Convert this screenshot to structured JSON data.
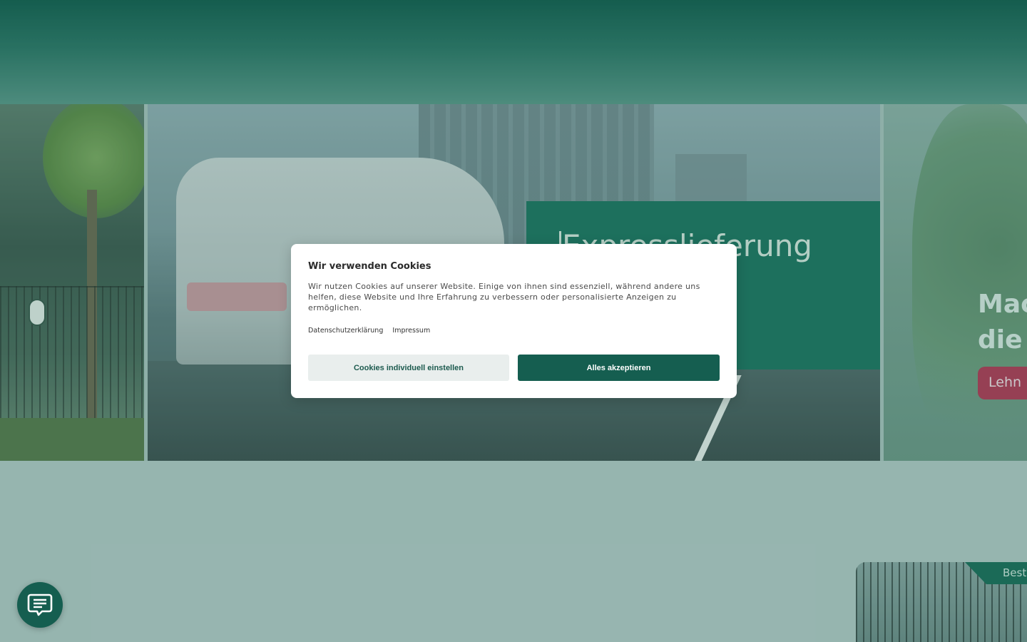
{
  "hero": {
    "promo_title": "Expresslieferung",
    "right_title_line1": "Mac",
    "right_title_line2": "die",
    "right_button": "Lehn"
  },
  "card": {
    "tag": "Best"
  },
  "cookie_modal": {
    "title": "Wir verwenden Cookies",
    "text": "Wir nutzen Cookies auf unserer Website. Einige von ihnen sind essenziell, während andere uns helfen, diese Website und Ihre Erfahrung zu verbessern oder personalisierte Anzeigen zu ermöglichen.",
    "link_privacy": "Datenschutzerklärung",
    "link_imprint": "Impressum",
    "btn_customize": "Cookies individuell einstellen",
    "btn_accept": "Alles akzeptieren"
  },
  "colors": {
    "brand": "#155e50",
    "accent_red": "#b23a56",
    "promo_green": "#1f7561"
  },
  "icons": {
    "chat": "chat-icon"
  }
}
